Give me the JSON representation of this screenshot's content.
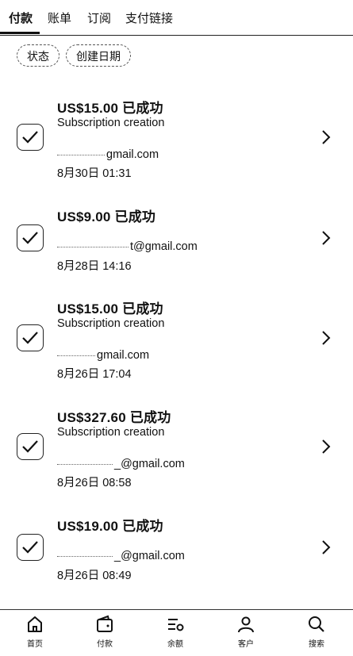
{
  "tabs": [
    "付款",
    "账单",
    "订阅",
    "支付链接"
  ],
  "filters": {
    "status": "状态",
    "created_date": "创建日期"
  },
  "payments": [
    {
      "amount": "US$15.00",
      "status": "已成功",
      "description": "Subscription creation",
      "email_suffix": "gmail.com",
      "date": "8月30日 01:31"
    },
    {
      "amount": "US$9.00",
      "status": "已成功",
      "description": "",
      "email_suffix": "t@gmail.com",
      "date": "8月28日 14:16"
    },
    {
      "amount": "US$15.00",
      "status": "已成功",
      "description": "Subscription creation",
      "email_suffix": "gmail.com",
      "date": "8月26日 17:04"
    },
    {
      "amount": "US$327.60",
      "status": "已成功",
      "description": "Subscription creation",
      "email_suffix": "_@gmail.com",
      "date": "8月26日 08:58"
    },
    {
      "amount": "US$19.00",
      "status": "已成功",
      "description": "",
      "email_suffix": "_@gmail.com",
      "date": "8月26日 08:49"
    }
  ],
  "bottom_nav": [
    {
      "label": "首页",
      "icon": "home-icon"
    },
    {
      "label": "付款",
      "icon": "wallet-icon"
    },
    {
      "label": "余额",
      "icon": "balance-icon"
    },
    {
      "label": "客户",
      "icon": "user-icon"
    },
    {
      "label": "搜索",
      "icon": "search-icon"
    }
  ]
}
